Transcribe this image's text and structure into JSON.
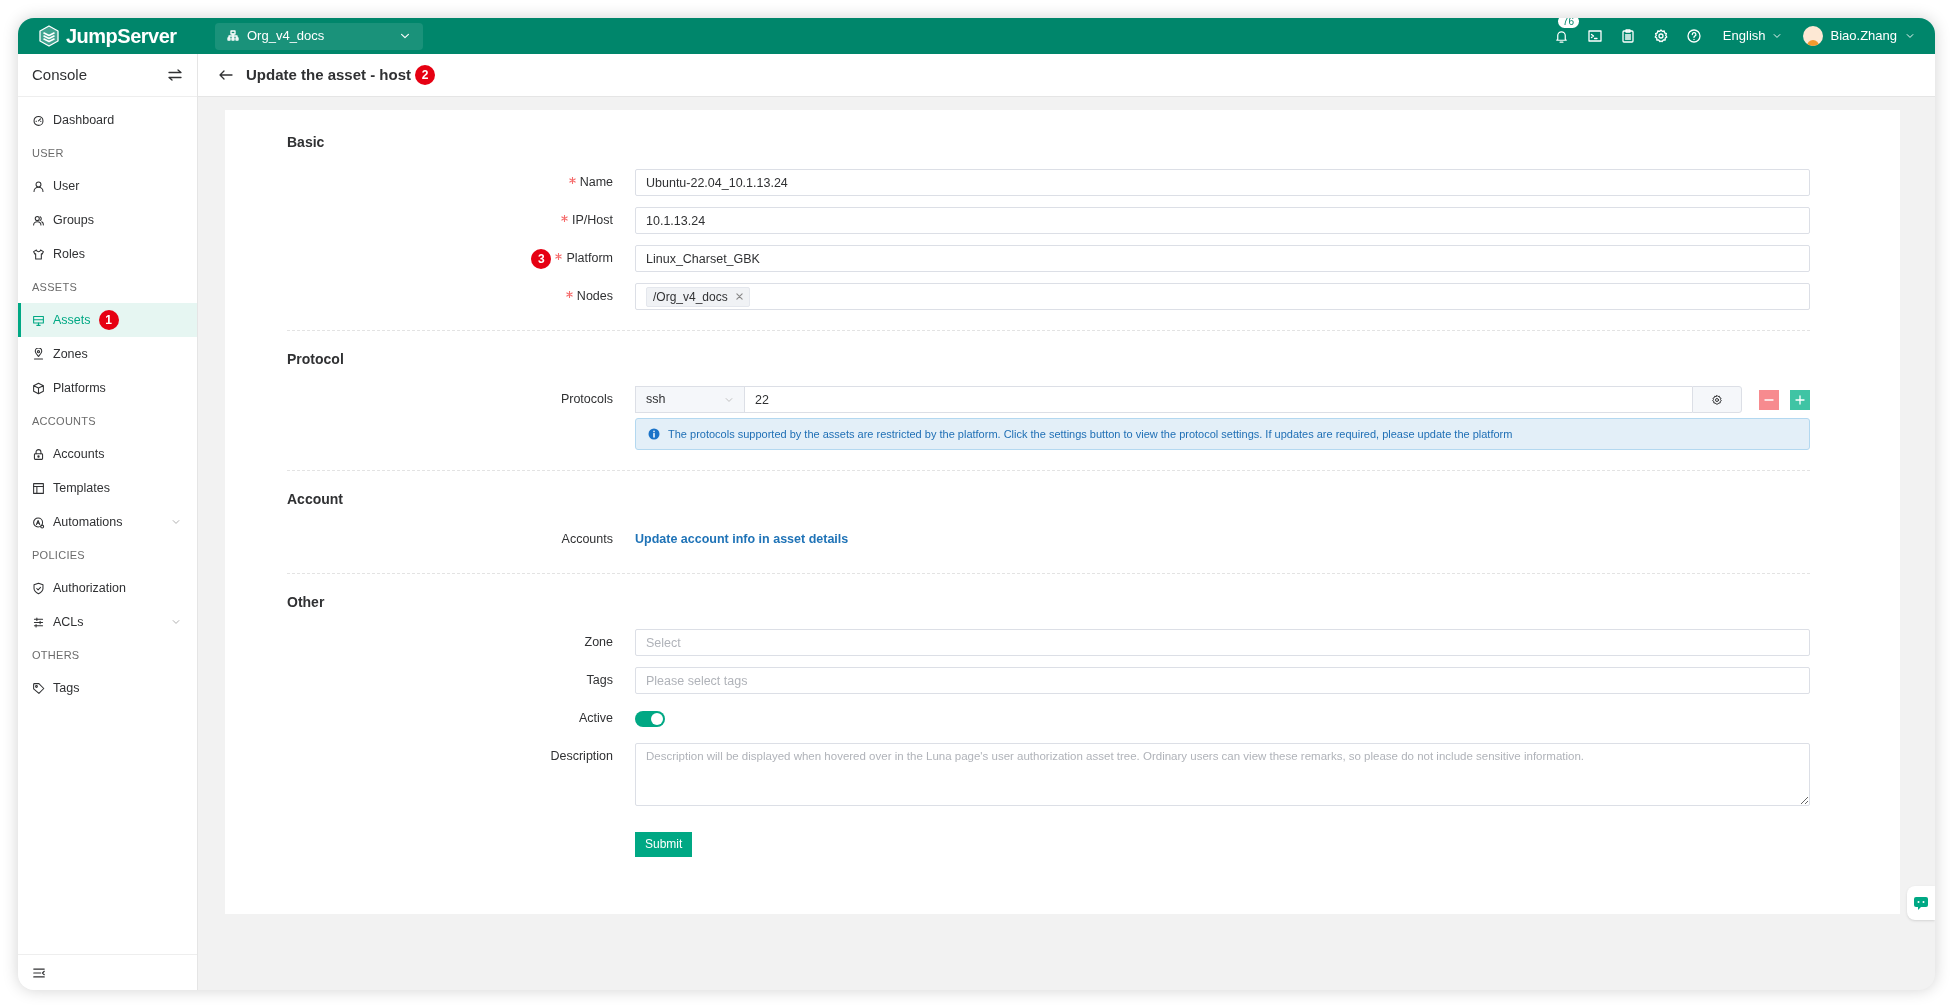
{
  "header": {
    "brand": "JumpServer",
    "org": "Org_v4_docs",
    "notification_count": "76",
    "language": "English",
    "user": "Biao.Zhang"
  },
  "sidebar": {
    "title": "Console",
    "items": [
      {
        "kind": "item",
        "label": "Dashboard",
        "selected": false
      },
      {
        "kind": "section",
        "label": "USER"
      },
      {
        "kind": "item",
        "label": "User",
        "selected": false
      },
      {
        "kind": "item",
        "label": "Groups",
        "selected": false
      },
      {
        "kind": "item",
        "label": "Roles",
        "selected": false
      },
      {
        "kind": "section",
        "label": "ASSETS"
      },
      {
        "kind": "item",
        "label": "Assets",
        "selected": true,
        "marker": "1"
      },
      {
        "kind": "item",
        "label": "Zones",
        "selected": false
      },
      {
        "kind": "item",
        "label": "Platforms",
        "selected": false
      },
      {
        "kind": "section",
        "label": "ACCOUNTS"
      },
      {
        "kind": "item",
        "label": "Accounts",
        "selected": false
      },
      {
        "kind": "item",
        "label": "Templates",
        "selected": false
      },
      {
        "kind": "group",
        "label": "Automations",
        "selected": false
      },
      {
        "kind": "section",
        "label": "POLICIES"
      },
      {
        "kind": "item",
        "label": "Authorization",
        "selected": false
      },
      {
        "kind": "group",
        "label": "ACLs",
        "selected": false
      },
      {
        "kind": "section",
        "label": "OTHERS"
      },
      {
        "kind": "item",
        "label": "Tags",
        "selected": false
      }
    ]
  },
  "page": {
    "title": "Update the asset - host",
    "marker": "2"
  },
  "form": {
    "sections": [
      {
        "title": "Basic",
        "fields": [
          {
            "kind": "text",
            "label": "Name",
            "required": true,
            "value": "Ubuntu-22.04_10.1.13.24"
          },
          {
            "kind": "text",
            "label": "IP/Host",
            "required": true,
            "value": "10.1.13.24"
          },
          {
            "kind": "text",
            "label": "Platform",
            "required": true,
            "value": "Linux_Charset_GBK",
            "marker": "3"
          },
          {
            "kind": "tags",
            "label": "Nodes",
            "required": true,
            "tags": [
              "/Org_v4_docs"
            ]
          }
        ]
      },
      {
        "title": "Protocol",
        "fields": [
          {
            "kind": "protocols",
            "label": "Protocols",
            "required": false,
            "protocols": [
              {
                "name": "ssh",
                "port": "22"
              }
            ],
            "info": "The protocols supported by the assets are restricted by the platform. Click the settings button to view the protocol settings. If updates are required, please update the platform"
          }
        ]
      },
      {
        "title": "Account",
        "fields": [
          {
            "kind": "link",
            "label": "Accounts",
            "required": false,
            "text": "Update account info in asset details"
          }
        ]
      },
      {
        "title": "Other",
        "fields": [
          {
            "kind": "select",
            "label": "Zone",
            "required": false,
            "placeholder": "Select"
          },
          {
            "kind": "select",
            "label": "Tags",
            "required": false,
            "placeholder": "Please select tags"
          },
          {
            "kind": "switch",
            "label": "Active",
            "required": false,
            "on": true
          },
          {
            "kind": "textarea",
            "label": "Description",
            "required": false,
            "placeholder": "Description will be displayed when hovered over in the Luna page's user authorization asset tree. Ordinary users can view these remarks, so please do not include sensitive information."
          }
        ]
      }
    ],
    "submit": "Submit"
  }
}
